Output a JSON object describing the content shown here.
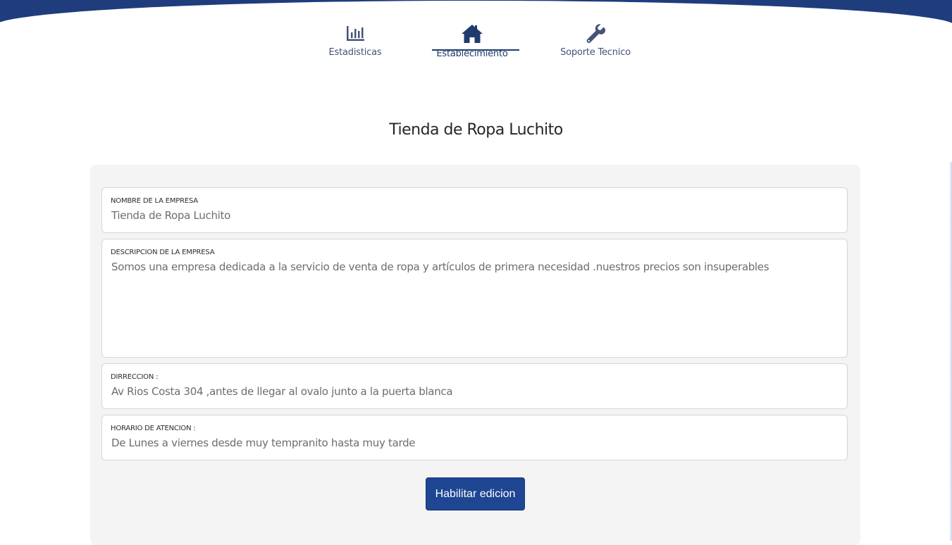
{
  "nav": {
    "items": [
      {
        "label": "Estadisticas",
        "icon": "bar-chart-icon",
        "active": false
      },
      {
        "label": "Establecimiento",
        "icon": "home-icon",
        "active": true
      },
      {
        "label": "Soporte Tecnico",
        "icon": "wrench-icon",
        "active": false
      }
    ]
  },
  "page": {
    "title": "Tienda de Ropa Luchito"
  },
  "form": {
    "nombre": {
      "label": "NOMBRE DE LA EMPRESA",
      "value": "Tienda de Ropa Luchito"
    },
    "descripcion": {
      "label": "DESCRIPCION DE LA EMPRESA",
      "value": "Somos una empresa dedicada a la servicio de venta de ropa y artículos de primera necesidad .nuestros precios son insuperables"
    },
    "direccion": {
      "label": "DIRRECCION :",
      "value": "Av Rios Costa 304 ,antes de llegar al ovalo junto a la puerta blanca"
    },
    "horario": {
      "label": "HORARIO DE ATENCION :",
      "value": "De Lunes a viernes desde muy tempranito hasta muy tarde"
    },
    "submit_label": "Habilitar edicion"
  },
  "colors": {
    "brand": "#1f4692",
    "nav_text": "#45527a",
    "card_bg": "#f4f4f4"
  }
}
